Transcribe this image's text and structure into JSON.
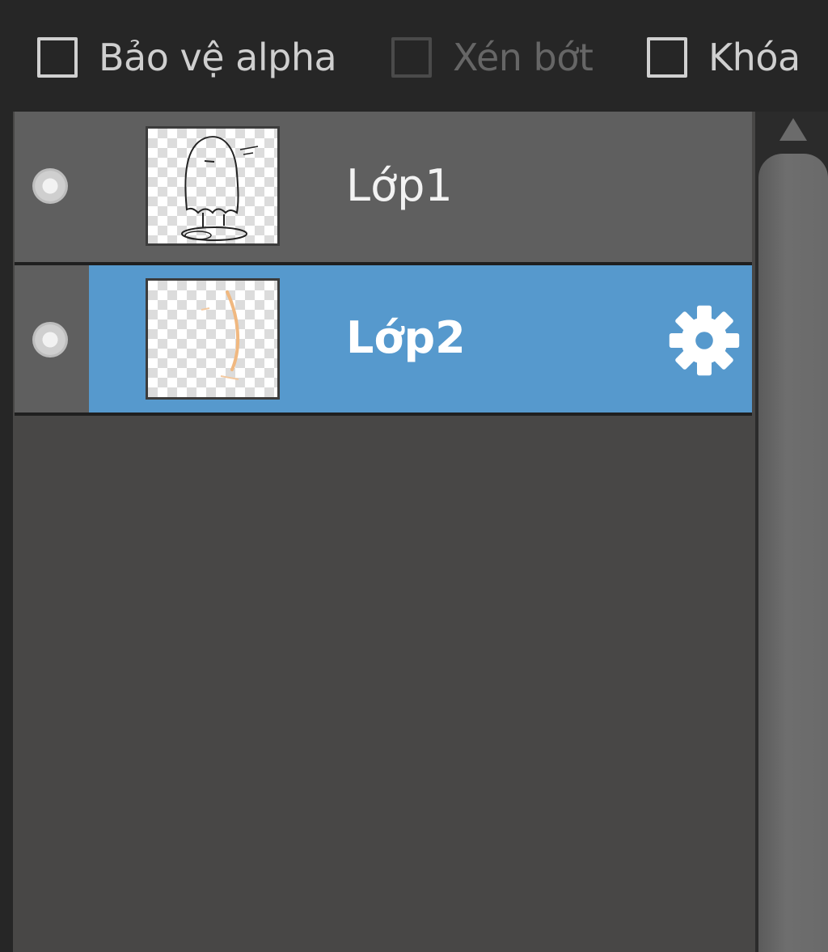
{
  "toolbar": {
    "options": [
      {
        "label": "Bảo vệ alpha",
        "checked": false,
        "enabled": true
      },
      {
        "label": "Xén bớt",
        "checked": false,
        "enabled": false
      },
      {
        "label": "Khóa",
        "checked": false,
        "enabled": true
      }
    ]
  },
  "layers": [
    {
      "name": "Lớp1",
      "selected": false,
      "visible": true,
      "thumbnail": "ghost-sketch"
    },
    {
      "name": "Lớp2",
      "selected": true,
      "visible": true,
      "thumbnail": "orange-stroke",
      "settings_icon": "gear-icon"
    }
  ],
  "colors": {
    "selection": "#5699cd",
    "panel_bg": "#484746",
    "row_bg": "#5f5f5f"
  }
}
